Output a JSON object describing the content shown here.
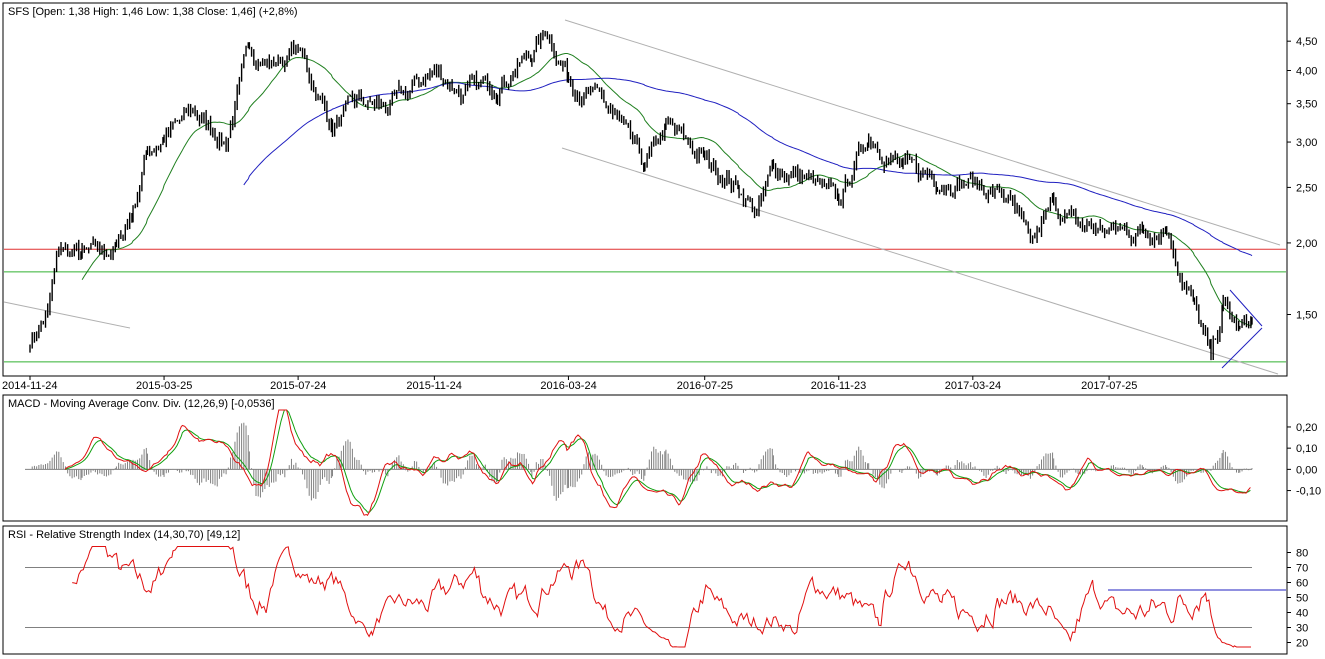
{
  "chart_data": [
    {
      "type": "candlestick",
      "title": "SFS [Open: 1,38  High: 1,46  Low: 1,38  Close: 1,46] (+2,8%)",
      "ylabels": [
        "4,50",
        "4,00",
        "3,50",
        "3,00",
        "2,50",
        "2,00",
        "1,50"
      ],
      "yscale": "log",
      "ylim": [
        1.2,
        4.9
      ],
      "xlabels": [
        "2014-11-24",
        "2015-03-25",
        "2015-07-24",
        "2015-11-24",
        "2016-03-24",
        "2016-07-25",
        "2016-11-23",
        "2017-03-24",
        "2017-07-25"
      ],
      "price_anchors": [
        {
          "date": "2014-11-24",
          "close": 1.35
        },
        {
          "date": "2014-12-10",
          "close": 1.5
        },
        {
          "date": "2014-12-20",
          "close": 1.95
        },
        {
          "date": "2015-01-10",
          "close": 1.9
        },
        {
          "date": "2015-02-10",
          "close": 1.95
        },
        {
          "date": "2015-02-25",
          "close": 2.3
        },
        {
          "date": "2015-03-10",
          "close": 2.9
        },
        {
          "date": "2015-03-25",
          "close": 3.05
        },
        {
          "date": "2015-04-20",
          "close": 3.4
        },
        {
          "date": "2015-05-20",
          "close": 3.0
        },
        {
          "date": "2015-06-10",
          "close": 4.4
        },
        {
          "date": "2015-06-30",
          "close": 4.1
        },
        {
          "date": "2015-07-24",
          "close": 4.35
        },
        {
          "date": "2015-08-24",
          "close": 3.2
        },
        {
          "date": "2015-09-15",
          "close": 3.5
        },
        {
          "date": "2015-10-15",
          "close": 3.45
        },
        {
          "date": "2015-11-24",
          "close": 4.0
        },
        {
          "date": "2015-12-20",
          "close": 3.65
        },
        {
          "date": "2016-01-20",
          "close": 3.8
        },
        {
          "date": "2016-02-20",
          "close": 4.3
        },
        {
          "date": "2016-03-05",
          "close": 4.7
        },
        {
          "date": "2016-03-24",
          "close": 3.9
        },
        {
          "date": "2016-05-01",
          "close": 3.4
        },
        {
          "date": "2016-06-01",
          "close": 2.7
        },
        {
          "date": "2016-06-20",
          "close": 3.2
        },
        {
          "date": "2016-07-25",
          "close": 2.8
        },
        {
          "date": "2016-08-25",
          "close": 2.5
        },
        {
          "date": "2016-09-10",
          "close": 2.25
        },
        {
          "date": "2016-09-25",
          "close": 2.7
        },
        {
          "date": "2016-10-25",
          "close": 2.6
        },
        {
          "date": "2016-11-23",
          "close": 2.35
        },
        {
          "date": "2016-12-20",
          "close": 3.1
        },
        {
          "date": "2017-01-20",
          "close": 2.7
        },
        {
          "date": "2017-02-20",
          "close": 2.6
        },
        {
          "date": "2017-03-24",
          "close": 2.55
        },
        {
          "date": "2017-04-25",
          "close": 2.4
        },
        {
          "date": "2017-05-15",
          "close": 1.95
        },
        {
          "date": "2017-06-05",
          "close": 2.35
        },
        {
          "date": "2017-06-25",
          "close": 2.15
        },
        {
          "date": "2017-07-25",
          "close": 2.1
        },
        {
          "date": "2017-08-25",
          "close": 2.1
        },
        {
          "date": "2017-09-15",
          "close": 2.15
        },
        {
          "date": "2017-09-25",
          "close": 1.85
        },
        {
          "date": "2017-10-10",
          "close": 1.55
        },
        {
          "date": "2017-10-25",
          "close": 1.25
        },
        {
          "date": "2017-11-05",
          "close": 1.55
        },
        {
          "date": "2017-11-20",
          "close": 1.4
        },
        {
          "date": "2017-12-01",
          "close": 1.46
        }
      ],
      "horizontal_levels": [
        {
          "value": 1.95,
          "color": "#e03030"
        },
        {
          "value": 1.78,
          "color": "#30b030"
        },
        {
          "value": 1.24,
          "color": "#30b030"
        }
      ],
      "moving_averages": [
        {
          "color": "#208020"
        },
        {
          "color": "#2020c0"
        }
      ],
      "colors": {
        "price": "#000000",
        "grid": "#a0a0a0",
        "trend": "#b0b0b0"
      }
    },
    {
      "type": "line",
      "title": "MACD - Moving Average Conv. Div. (12,26,9) [-0,0536]",
      "ylabels": [
        "0,20",
        "0,10",
        "0,00",
        "-0,10"
      ],
      "ylim": [
        -0.22,
        0.28
      ],
      "colors": {
        "macd": "#e01010",
        "signal": "#10a010",
        "histogram": "#808080"
      }
    },
    {
      "type": "line",
      "title": "RSI - Relative Strength Index (14,30,70) [49,12]",
      "ylabels": [
        "80",
        "70",
        "60",
        "50",
        "40",
        "30",
        "20"
      ],
      "ylim": [
        15,
        85
      ],
      "levels": [
        30,
        70
      ],
      "last_value": 49.12,
      "colors": {
        "rsi": "#e01010",
        "level": "#808080",
        "marker": "#2020c0"
      }
    }
  ]
}
